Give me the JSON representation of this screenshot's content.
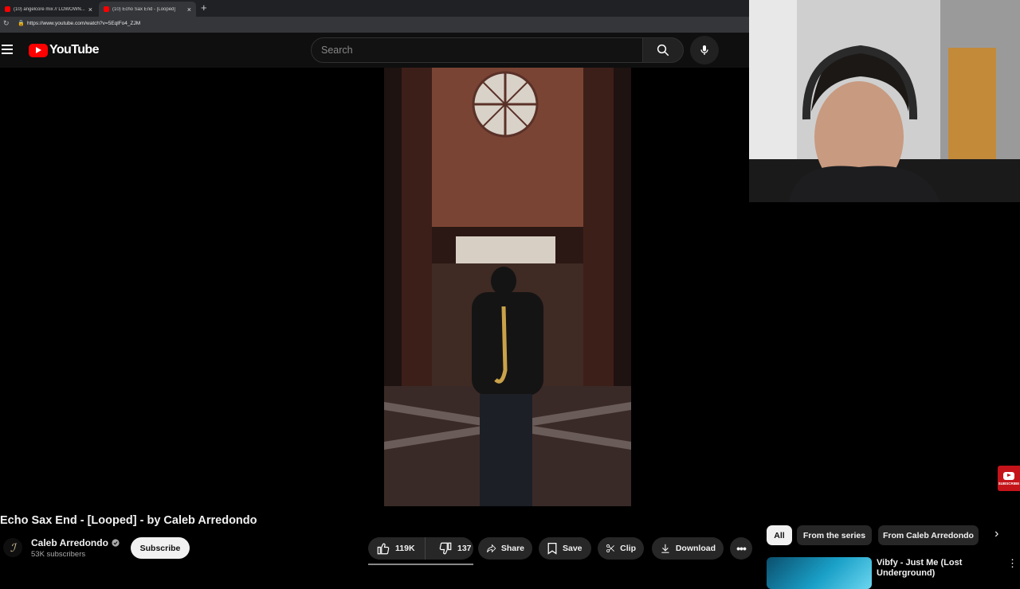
{
  "browser": {
    "tabs": [
      {
        "title": "(10) angelcore mix // LOWOWN..."
      },
      {
        "title": "(10) Echo Sax End - [Looped]"
      }
    ],
    "url": "https://www.youtube.com/watch?v=5EqlFo4_ZJM"
  },
  "header": {
    "logo_text": "YouTube",
    "search_placeholder": "Search"
  },
  "video": {
    "title": "Echo Sax End - [Looped] - by Caleb Arredondo",
    "channel_name": "Caleb Arredondo",
    "subscribers": "53K subscribers",
    "subscribe_label": "Subscribe",
    "likes": "119K",
    "dislikes": "137",
    "actions": {
      "share": "Share",
      "save": "Save",
      "clip": "Clip",
      "download": "Download"
    }
  },
  "sidebar": {
    "chips": [
      "All",
      "From the series",
      "From Caleb Arredondo"
    ],
    "recommendation": {
      "title": "Vibfy - Just Me (Lost Underground)"
    }
  },
  "overlay": {
    "subscribe_badge": "SUBSCRIBE"
  },
  "colors": {
    "brand_red": "#ff0000",
    "background": "#0f0f0f"
  }
}
